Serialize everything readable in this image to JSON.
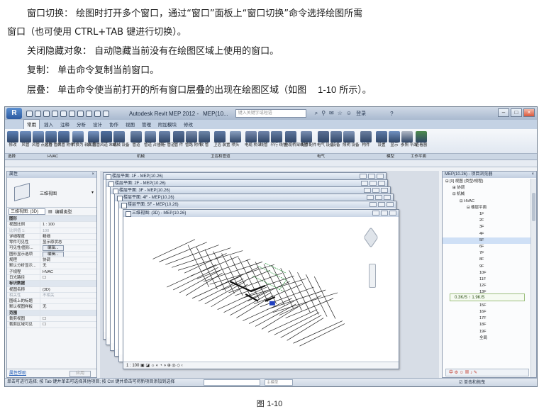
{
  "paragraphs": {
    "window_switch": {
      "term": "窗口切换：",
      "text1": "绘图时打开多个窗口，通过“窗口”面板上“窗口切换”命令选择绘图所需",
      "text2": "窗口（也可使用   CTRL+TAB  键进行切换）。"
    },
    "close_hidden": {
      "term": "关闭隐藏对象：",
      "text": "自动隐藏当前没有在绘图区域上使用的窗口。"
    },
    "copy": {
      "term": "复制：",
      "text": "单击命令复制当前窗口。"
    },
    "cascade": {
      "term": "层叠：",
      "text": "单击命令使当前打开的所有窗口层叠的出现在绘图区域（如图",
      "figref": "1-10",
      "tail": "所示）。"
    }
  },
  "app": {
    "title": "Autodesk Revit MEP 2012 -",
    "title_doc": "MEP(10...",
    "search_placeholder": "键入关键字或短语",
    "user": "登录",
    "help": "?"
  },
  "tabs": [
    "常用",
    "插入",
    "注释",
    "分析",
    "设计",
    "协作",
    "视图",
    "管理",
    "附加模块",
    "修改"
  ],
  "ribbon": {
    "items": [
      {
        "label": "修改",
        "color": "#5a7fb5"
      },
      {
        "label": "风管",
        "color": "#6f8fbf"
      },
      {
        "label": "风管 点位符",
        "color": "#7d9bc8"
      },
      {
        "label": "风管 管件",
        "color": "#6a8ab8"
      },
      {
        "label": "风管 附件",
        "color": "#5c7cae"
      },
      {
        "label": "转换为 软风管",
        "color": "#8aa5cf"
      },
      {
        "label": "软 风管",
        "color": "#7794c2"
      },
      {
        "label": "风道 末端",
        "color": "#4f6f9f"
      },
      {
        "label": "机械 设备",
        "color": "#6b86b0"
      },
      {
        "label": "管道",
        "color": "#7289ad"
      },
      {
        "label": "管道 占位符",
        "color": "#8199bd"
      },
      {
        "label": "平行 管道",
        "color": "#6b84ab"
      },
      {
        "label": "管 件",
        "color": "#5a7299"
      },
      {
        "label": "管路 附件",
        "color": "#7d8fae"
      },
      {
        "label": "软 管",
        "color": "#6e86a8"
      },
      {
        "label": "卫浴 装置",
        "color": "#5f7aa4"
      },
      {
        "label": "喷头",
        "color": "#8aa0c0"
      },
      {
        "label": "电缆 桥架",
        "color": "#7b8db0"
      },
      {
        "label": "线管",
        "color": "#6f84aa"
      },
      {
        "label": "平行 线管",
        "color": "#6780a6"
      },
      {
        "label": "电缆桥架 配件",
        "color": "#5e779e"
      },
      {
        "label": "线管 配件",
        "color": "#7a8fb2"
      },
      {
        "label": "电气 设备",
        "color": "#5a6f94"
      },
      {
        "label": "设备",
        "color": "#6c82a6"
      },
      {
        "label": "照明 设备",
        "color": "#8499bb"
      },
      {
        "label": "构件",
        "color": "#6b7fa0"
      },
      {
        "label": "设置",
        "color": "#5e7ba8"
      },
      {
        "label": "显示",
        "color": "#7090c0"
      },
      {
        "label": "参照 平面",
        "color": "#b0b8c4"
      },
      {
        "label": "查看器",
        "color": "#4d8a4d"
      }
    ],
    "groups": [
      "选择",
      "HVAC",
      "机械",
      "卫浴和管道",
      "电气",
      "模型",
      "工作平面"
    ]
  },
  "properties": {
    "title": "属性",
    "type_name": "三维视图",
    "view_select": "三维视图: (3D)",
    "edit_type": "编辑类型",
    "rows": [
      {
        "k": "图形",
        "v": "",
        "group": true
      },
      {
        "k": "视图比例",
        "v": "1 : 100"
      },
      {
        "k": "比例值 1:",
        "v": "100",
        "grey": true
      },
      {
        "k": "详细程度",
        "v": "精细"
      },
      {
        "k": "零件可见性",
        "v": "显示原状态"
      },
      {
        "k": "可见性/图形...",
        "v": "编辑...",
        "btn": true
      },
      {
        "k": "图形显示选项",
        "v": "编辑...",
        "btn": true
      },
      {
        "k": "规程",
        "v": "协调"
      },
      {
        "k": "默认分析显示...",
        "v": "无"
      },
      {
        "k": "子规程",
        "v": "HVAC"
      },
      {
        "k": "日光路径",
        "v": "☐"
      },
      {
        "k": "标识数据",
        "v": "",
        "group": true
      },
      {
        "k": "视图名称",
        "v": "(3D)"
      },
      {
        "k": "相关性",
        "v": "不相关",
        "grey": true
      },
      {
        "k": "图纸上的标题",
        "v": ""
      },
      {
        "k": "默认视图样板",
        "v": "无"
      },
      {
        "k": "范围",
        "v": "",
        "group": true
      },
      {
        "k": "裁剪视图",
        "v": "☐"
      },
      {
        "k": "裁剪区域可见",
        "v": "☐"
      }
    ],
    "help_link": "属性帮助",
    "apply": "应用"
  },
  "views": [
    {
      "title": "楼层平面: 1F - MEP(10.26)"
    },
    {
      "title": "楼层平面: 2F - MEP(10.26)"
    },
    {
      "title": "楼层平面: 3F - MEP(10.26)"
    },
    {
      "title": "楼层平面: 4F - MEP(10.26)"
    },
    {
      "title": "楼层平面: 5F - MEP(10.26)"
    },
    {
      "title": "三维视图: (3D) - MEP(10.26)"
    }
  ],
  "active_view_status": "1 : 100",
  "browser": {
    "title": "MEP(10.26) - 项目浏览器",
    "tree": [
      {
        "t": "⊟ [0] 视图 (类型/规程)",
        "lvl": 1
      },
      {
        "t": "⊞ 协调",
        "lvl": 2
      },
      {
        "t": "⊟ 机械",
        "lvl": 2
      },
      {
        "t": "⊟ HVAC",
        "lvl": 3
      },
      {
        "t": "⊟ 楼层平面",
        "lvl": 4
      },
      {
        "t": "1F",
        "lvl": 5
      },
      {
        "t": "2F",
        "lvl": 5
      },
      {
        "t": "3F",
        "lvl": 5
      },
      {
        "t": "4F",
        "lvl": 5
      },
      {
        "t": "5F",
        "lvl": 5,
        "sel": true
      },
      {
        "t": "6F",
        "lvl": 5
      },
      {
        "t": "7F",
        "lvl": 5
      },
      {
        "t": "8F",
        "lvl": 5
      },
      {
        "t": "9F",
        "lvl": 5
      },
      {
        "t": "10F",
        "lvl": 5
      },
      {
        "t": "11F",
        "lvl": 5
      },
      {
        "t": "12F",
        "lvl": 5
      },
      {
        "t": "13F",
        "lvl": 5
      },
      {
        "t": "14F",
        "lvl": 5
      },
      {
        "t": "15F",
        "lvl": 5
      },
      {
        "t": "16F",
        "lvl": 5
      },
      {
        "t": "17F",
        "lvl": 5
      },
      {
        "t": "18F",
        "lvl": 5
      },
      {
        "t": "19F",
        "lvl": 5
      },
      {
        "t": "全局",
        "lvl": 5
      }
    ],
    "toast": "0.3K/S  ↑ 1.9K/S",
    "tray": "中 ⚙ ☺ ▦ ♪ ✎"
  },
  "statusbar": {
    "text": "单击可进行选择; 按 Tab 键并单击可选择其他项目; 按 Ctrl 键并单击可将新项目添加到选择",
    "model": "主模型",
    "filter": "☑ 单击和拖曳"
  },
  "caption": {
    "prefix": "图",
    "number": "1-10"
  }
}
